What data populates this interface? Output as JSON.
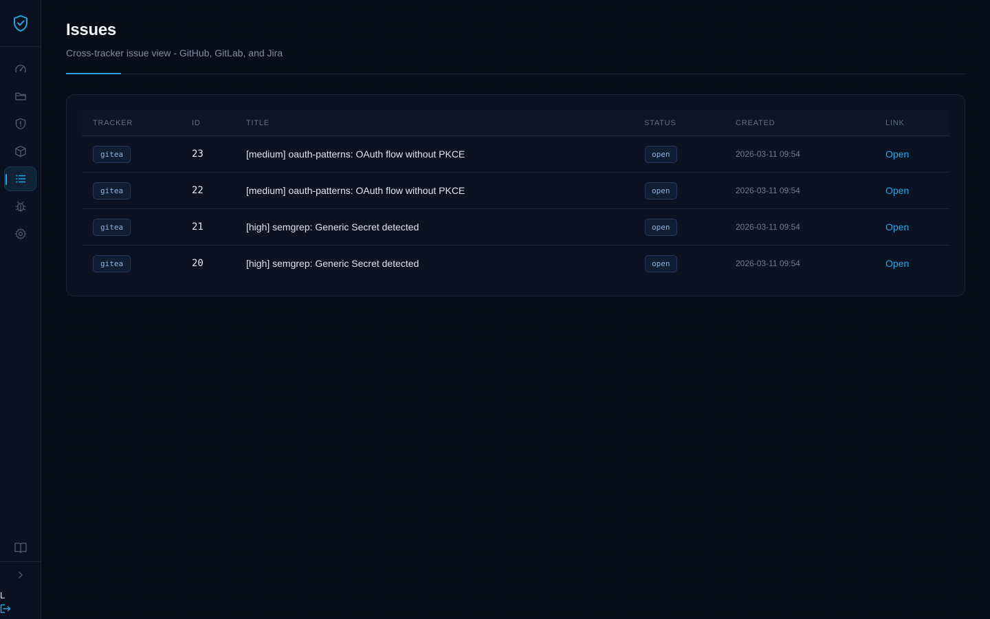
{
  "sidebar": {
    "logo_icon": "shield-check-icon",
    "nav": [
      {
        "name": "dashboard",
        "icon": "gauge-icon",
        "active": false
      },
      {
        "name": "projects",
        "icon": "folder-icon",
        "active": false
      },
      {
        "name": "findings",
        "icon": "shield-alert-icon",
        "active": false
      },
      {
        "name": "packages",
        "icon": "package-icon",
        "active": false
      },
      {
        "name": "issues",
        "icon": "list-icon",
        "active": true
      },
      {
        "name": "bugs",
        "icon": "bug-icon",
        "active": false
      },
      {
        "name": "settings",
        "icon": "gear-icon",
        "active": false
      }
    ],
    "docs_icon": "book-icon",
    "expand_icon": "chevron-right-icon",
    "user_initial": "L",
    "logout_icon": "logout-icon"
  },
  "page": {
    "title": "Issues",
    "subtitle": "Cross-tracker issue view - GitHub, GitLab, and Jira"
  },
  "table": {
    "headers": {
      "tracker": "TRACKER",
      "id": "ID",
      "title": "TITLE",
      "status": "STATUS",
      "created": "CREATED",
      "link": "LINK"
    },
    "rows": [
      {
        "tracker": "gitea",
        "id": "23",
        "title": "[medium] oauth-patterns: OAuth flow without PKCE",
        "status": "open",
        "created": "2026-03-11 09:54",
        "link": "Open"
      },
      {
        "tracker": "gitea",
        "id": "22",
        "title": "[medium] oauth-patterns: OAuth flow without PKCE",
        "status": "open",
        "created": "2026-03-11 09:54",
        "link": "Open"
      },
      {
        "tracker": "gitea",
        "id": "21",
        "title": "[high] semgrep: Generic Secret detected",
        "status": "open",
        "created": "2026-03-11 09:54",
        "link": "Open"
      },
      {
        "tracker": "gitea",
        "id": "20",
        "title": "[high] semgrep: Generic Secret detected",
        "status": "open",
        "created": "2026-03-11 09:54",
        "link": "Open"
      }
    ]
  },
  "colors": {
    "accent": "#22a7e0",
    "background": "#070d18",
    "card": "#0b1322"
  }
}
